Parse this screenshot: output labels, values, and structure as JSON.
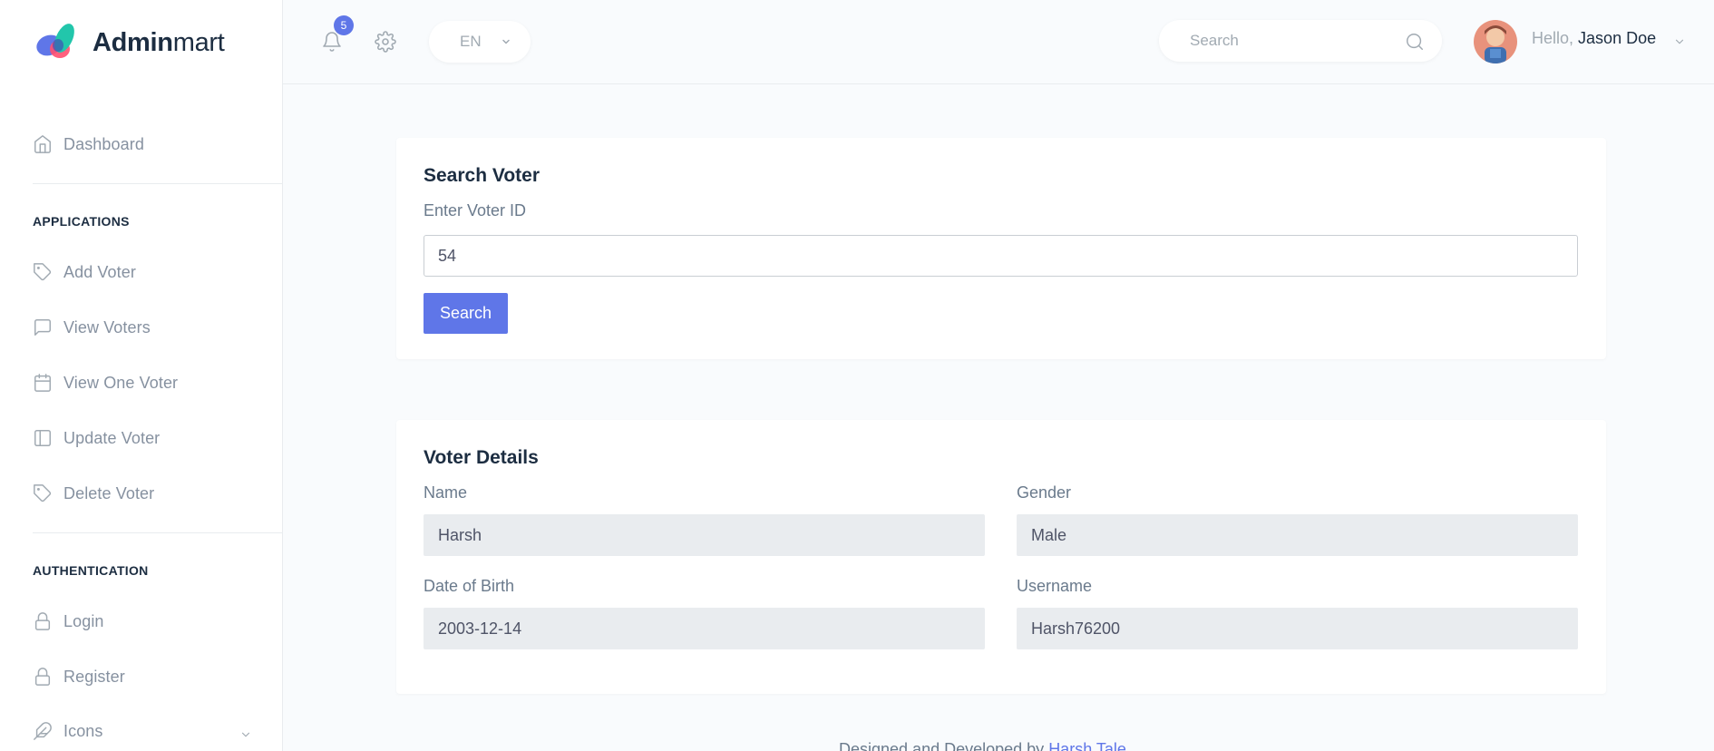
{
  "brand": {
    "name_bold": "Admin",
    "name_light": "mart"
  },
  "sidebar": {
    "dashboard": "Dashboard",
    "applications_title": "APPLICATIONS",
    "applications": [
      {
        "label": "Add Voter",
        "icon": "tag-icon"
      },
      {
        "label": "View Voters",
        "icon": "message-square-icon"
      },
      {
        "label": "View One Voter",
        "icon": "calendar-icon"
      },
      {
        "label": "Update Voter",
        "icon": "sidebar-layout-icon"
      },
      {
        "label": "Delete Voter",
        "icon": "tag-icon"
      }
    ],
    "authentication_title": "AUTHENTICATION",
    "authentication": [
      {
        "label": "Login",
        "icon": "lock-icon"
      },
      {
        "label": "Register",
        "icon": "lock-icon"
      },
      {
        "label": "Icons",
        "icon": "feather-icon"
      }
    ]
  },
  "topbar": {
    "notification_count": "5",
    "language": "EN",
    "search_placeholder": "Search",
    "greeting": "Hello,",
    "user_name": "Jason Doe"
  },
  "search_card": {
    "title": "Search Voter",
    "voter_id_label": "Enter Voter ID",
    "voter_id_value": "54",
    "search_button": "Search"
  },
  "details_card": {
    "title": "Voter Details",
    "name_label": "Name",
    "name_value": "Harsh",
    "gender_label": "Gender",
    "gender_value": "Male",
    "dob_label": "Date of Birth",
    "dob_value": "2003-12-14",
    "username_label": "Username",
    "username_value": "Harsh76200"
  },
  "footer": {
    "text": "Designed and Developed by",
    "author": "Harsh Tale"
  },
  "colors": {
    "accent": "#5f76e8",
    "heading": "#1c2d41",
    "muted": "#8691a0",
    "field_bg": "#e9ecef"
  }
}
